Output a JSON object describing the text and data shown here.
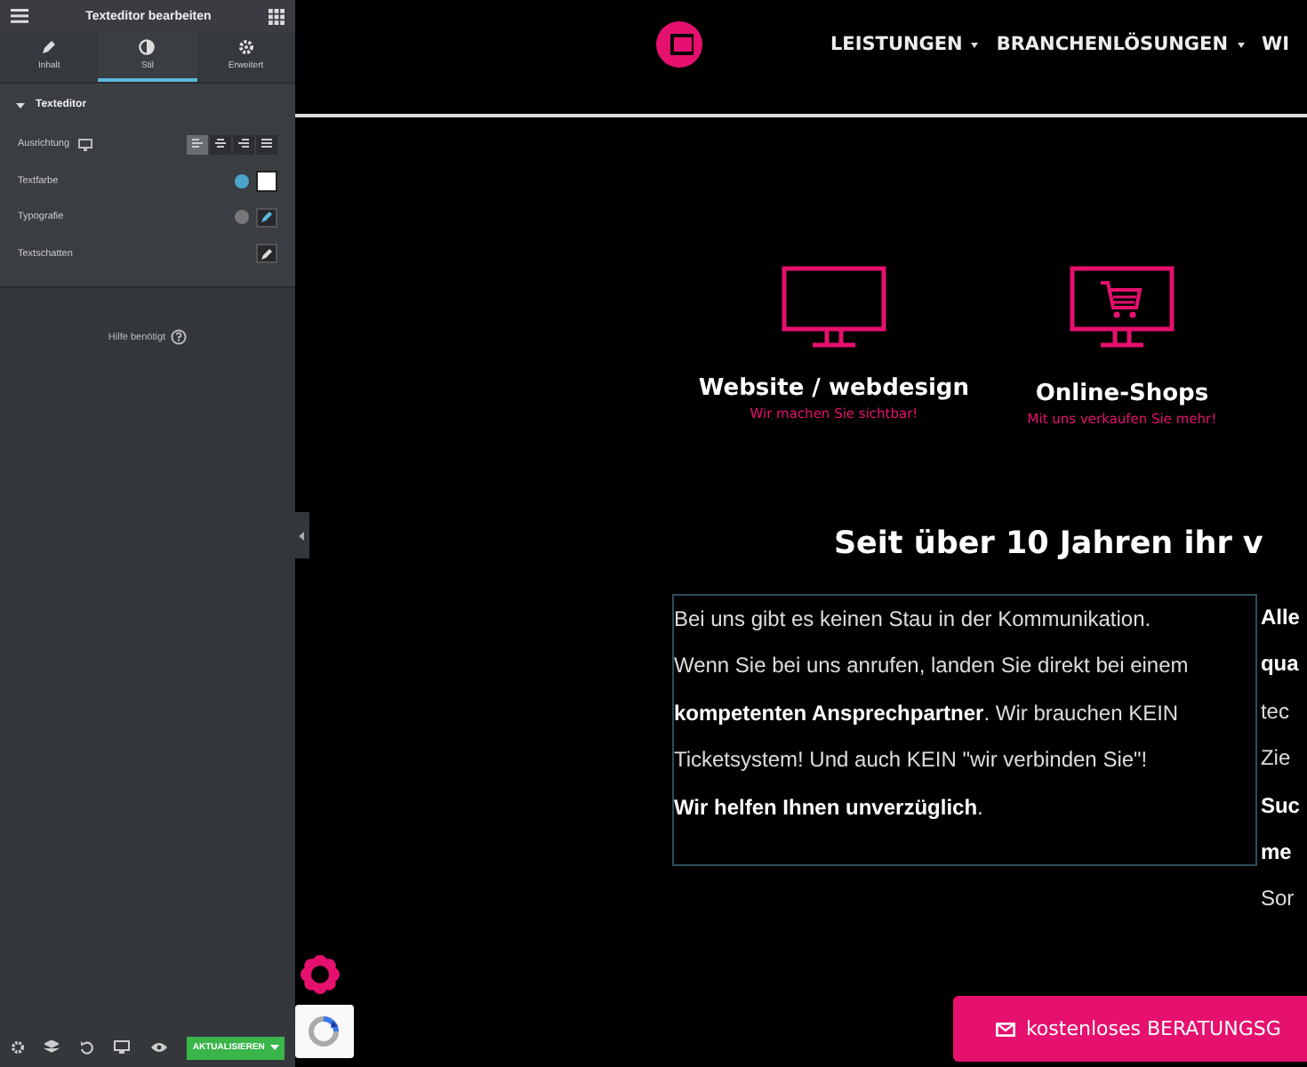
{
  "editor": {
    "title": "Texteditor bearbeiten",
    "tabs": [
      {
        "label": "Inhalt",
        "kind": "pencil",
        "selected": false
      },
      {
        "label": "Stil",
        "kind": "contrast",
        "selected": true
      },
      {
        "label": "Erweitert",
        "kind": "gear",
        "selected": false
      }
    ],
    "section": {
      "title": "Texteditor",
      "expanded": true
    },
    "controls": [
      {
        "label": "Ausrichtung",
        "kind": "align",
        "responsive": true,
        "options": [
          {
            "kind": "left",
            "selected": true
          },
          {
            "kind": "center",
            "selected": false
          },
          {
            "kind": "right",
            "selected": false
          },
          {
            "kind": "justify",
            "selected": false
          }
        ]
      },
      {
        "label": "Textfarbe",
        "kind": "color",
        "color": "#ffffff"
      },
      {
        "label": "Typografie",
        "kind": "typography"
      },
      {
        "label": "Textschatten",
        "kind": "shadow"
      }
    ],
    "help": "Hilfe benötigt",
    "publish": "AKTUALISIEREN"
  },
  "site": {
    "nav": [
      {
        "label": "LEISTUNGEN",
        "dropdown": true
      },
      {
        "label": "BRANCHENLÖSUNGEN",
        "dropdown": true
      },
      {
        "label": "WI",
        "dropdown": false
      }
    ],
    "services": [
      {
        "title": "Website / webdesign",
        "subtitle": "Wir machen Sie sichtbar!",
        "kind": "monitor"
      },
      {
        "title": "Online-Shops",
        "subtitle": "Mit uns verkaufen Sie mehr!",
        "kind": "cart"
      }
    ],
    "heading": "Seit über 10 Jahren ihr v",
    "text_editor": {
      "selected": true,
      "lines": [
        "Bei uns gibt es keinen Stau in der Kommunikation.",
        "Wenn Sie bei uns anrufen, landen Sie direkt bei einem",
        "**kompetenten Ansprechpartner**. Wir brauchen KEIN",
        "Ticketsystem! Und auch KEIN \"wir verbinden Sie\"!",
        "**Wir helfen Ihnen unverzüglich**."
      ]
    },
    "column_2": {
      "lines": [
        "**Alle**",
        "**qua**",
        "tec",
        "Zie",
        "**Suc**",
        "**me**",
        "Sor"
      ]
    },
    "cta": "kostenloses BERATUNGSG"
  }
}
